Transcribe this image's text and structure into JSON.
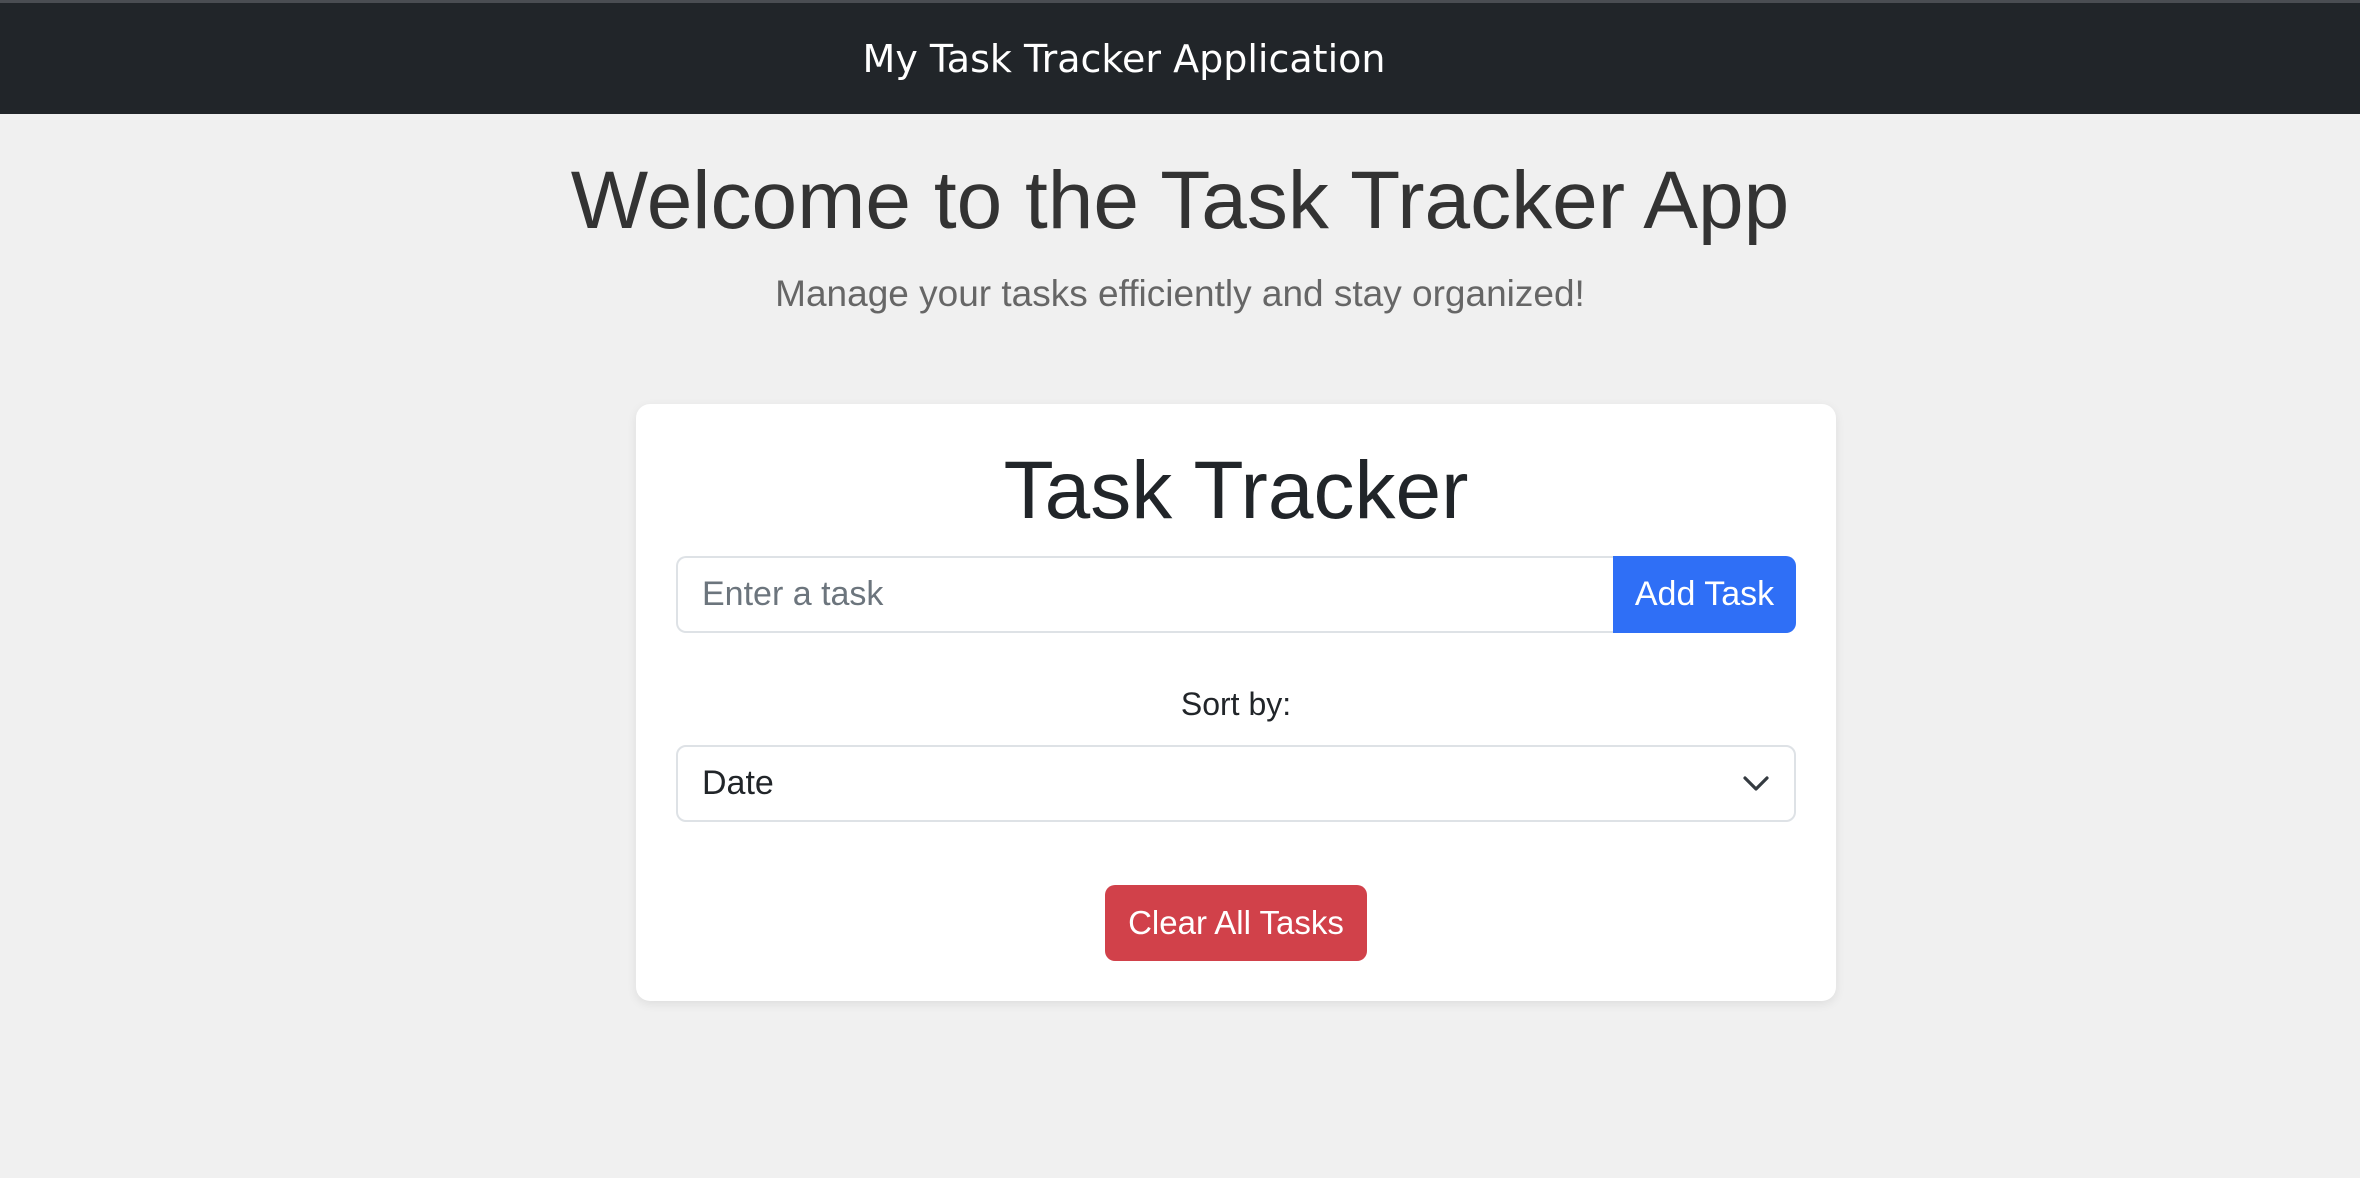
{
  "navbar": {
    "title": "My Task Tracker Application"
  },
  "hero": {
    "title": "Welcome to the Task Tracker App",
    "subtitle": "Manage your tasks efficiently and stay organized!"
  },
  "card": {
    "title": "Task Tracker",
    "task_input": {
      "value": "",
      "placeholder": "Enter a task"
    },
    "add_button_label": "Add Task",
    "sort_label": "Sort by:",
    "sort_select": {
      "selected": "Date",
      "icon": "chevron-down-icon"
    },
    "clear_button_label": "Clear All Tasks"
  },
  "colors": {
    "navbar_bg": "#212529",
    "page_bg": "#f0f0f0",
    "primary": "#2f6ff6",
    "danger": "#d1414a"
  }
}
